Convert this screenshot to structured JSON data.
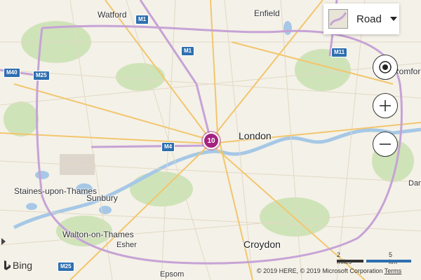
{
  "map": {
    "places": [
      {
        "text": "Watford",
        "size": "mid"
      },
      {
        "text": "Enfield",
        "size": "mid"
      },
      {
        "text": "London",
        "size": "big"
      },
      {
        "text": "Romford",
        "size": "mid"
      },
      {
        "text": "Staines-upon-Thames",
        "size": "mid"
      },
      {
        "text": "Sunbury",
        "size": "mid"
      },
      {
        "text": "Walton-on-Thames",
        "size": "mid"
      },
      {
        "text": "Esher",
        "size": "small"
      },
      {
        "text": "Croydon",
        "size": "big"
      },
      {
        "text": "Epsom",
        "size": "small"
      },
      {
        "text": "Dar",
        "size": "small"
      }
    ],
    "roads": [
      "M1",
      "M1",
      "M11",
      "M40",
      "M25",
      "M4",
      "M25"
    ],
    "cluster": {
      "count": "10",
      "color": "#a3237f"
    },
    "water_color": "#a6c8e6",
    "land_color": "#f4f1e8",
    "road_color": "#f2c66d",
    "park_color": "#cfe3b8"
  },
  "style_picker": {
    "label": "Road",
    "icon": "road-style-thumbnail"
  },
  "controls": {
    "locate": "my-location-icon",
    "zoom_in": "plus-icon",
    "zoom_out": "minus-icon"
  },
  "scale": {
    "miles": "2 miles",
    "km": "5 km"
  },
  "logo": {
    "text": "Bing"
  },
  "attribution": {
    "text": "© 2019 HERE, © 2019 Microsoft Corporation",
    "terms": "Terms"
  }
}
